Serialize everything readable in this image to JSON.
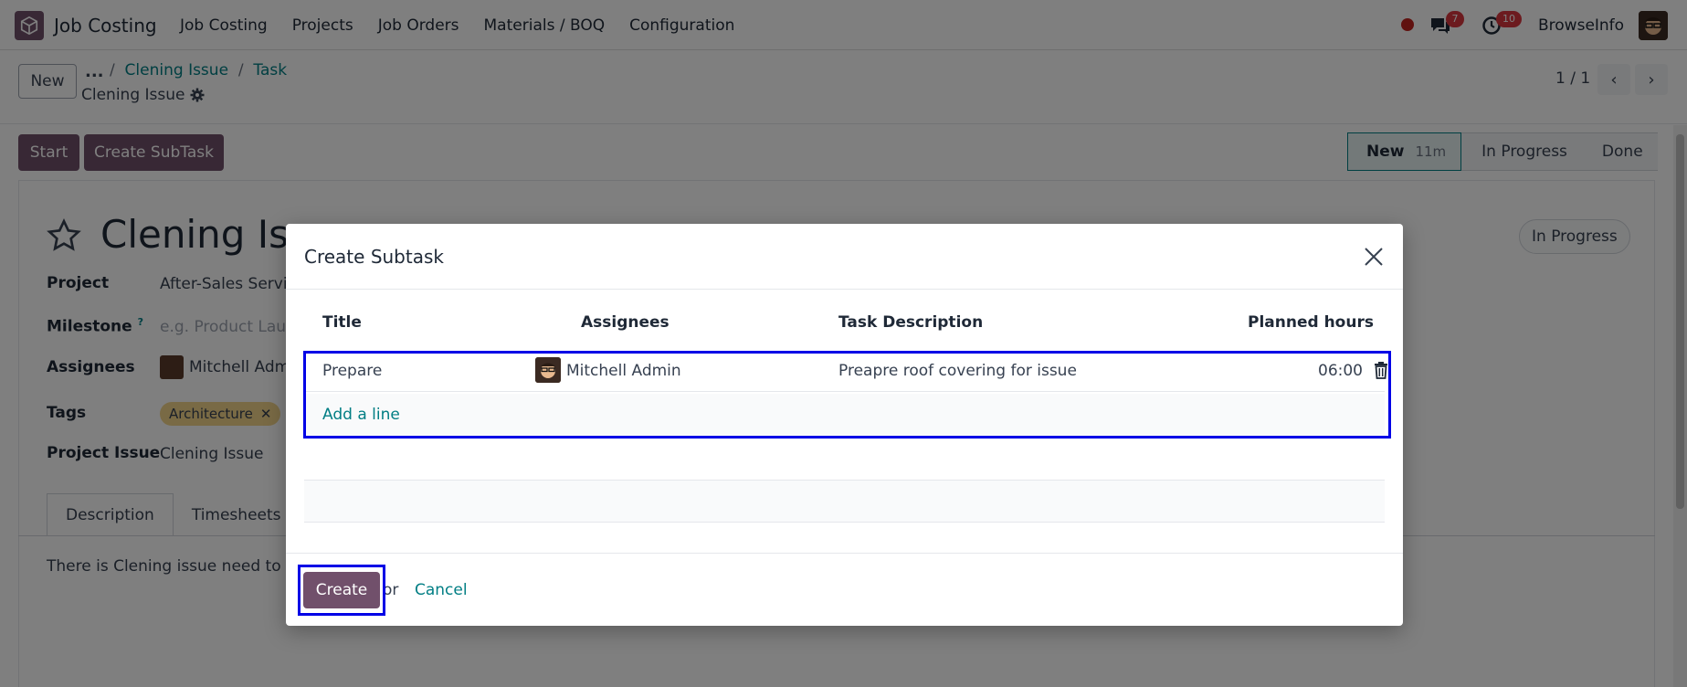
{
  "navbar": {
    "app_name": "Job Costing",
    "menu": [
      "Job Costing",
      "Projects",
      "Job Orders",
      "Materials / BOQ",
      "Configuration"
    ],
    "messages_count": "7",
    "activities_count": "10",
    "company": "BrowseInfo"
  },
  "control": {
    "new_label": "New",
    "breadcrumb_dots": "...",
    "breadcrumb": [
      "Clening Issue",
      "Task"
    ],
    "record_title": "Clening Issue",
    "pager": "1 / 1"
  },
  "statusbar": {
    "start_label": "Start",
    "create_subtask_label": "Create SubTask",
    "stages": [
      {
        "label": "New",
        "duration": "11m"
      },
      {
        "label": "In Progress"
      },
      {
        "label": "Done"
      }
    ]
  },
  "form": {
    "task_name": "Clening Iss",
    "state_tag": "In Progress",
    "project_label": "Project",
    "project_value": "After-Sales Servic",
    "milestone_label": "Milestone",
    "milestone_help": "?",
    "milestone_placeholder": "e.g. Product Laun",
    "assignees_label": "Assignees",
    "assignees_value": "Mitchell Admin",
    "tags_label": "Tags",
    "tag_value": "Architecture",
    "issue_label": "Project Issue",
    "issue_value": "Clening Issue",
    "tabs": [
      "Description",
      "Timesheets"
    ],
    "description": "There is Clening issue need to res"
  },
  "modal": {
    "title": "Create Subtask",
    "columns": [
      "Title",
      "Assignees",
      "Task Description",
      "Planned hours"
    ],
    "row": {
      "title": "Prepare",
      "assignee": "Mitchell Admin",
      "description": "Preapre roof covering for issue",
      "hours": "06:00"
    },
    "add_line": "Add a line",
    "create_label": "Create",
    "or_text": "or",
    "cancel_label": "Cancel"
  },
  "colors": {
    "primary": "#71506b",
    "link": "#017e84",
    "highlight": "#0000e6",
    "badge": "#d9363e"
  }
}
